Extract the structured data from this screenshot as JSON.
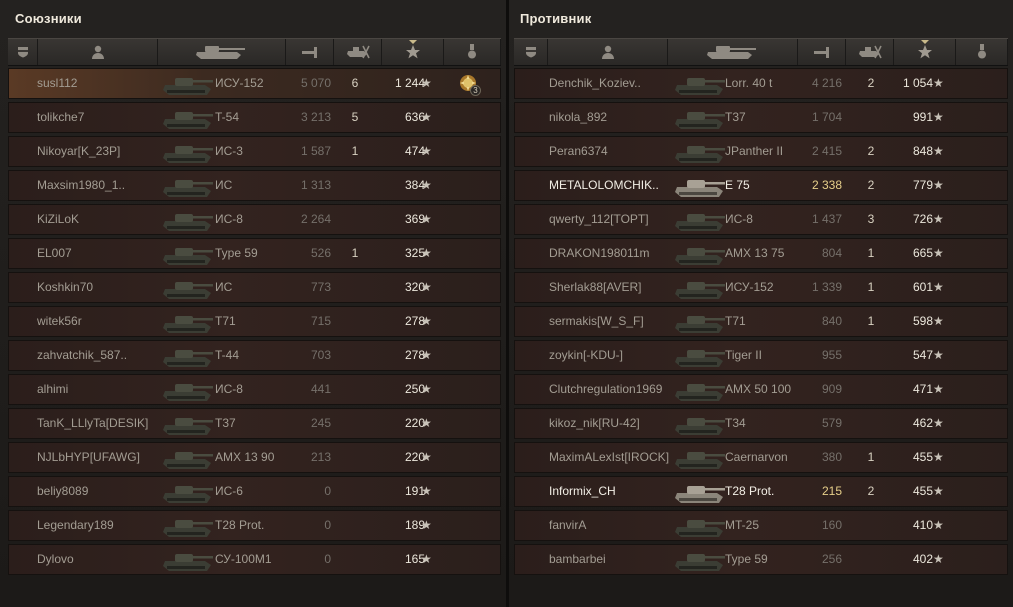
{
  "allies": {
    "title": "Союзники",
    "rows": [
      {
        "name": "susl112",
        "vehicle": "ИСУ-152",
        "damage": "5 070",
        "kills": "6",
        "xp": "1 244",
        "highlight": true,
        "alive": false,
        "medal_count": "3"
      },
      {
        "name": "tolikche7",
        "vehicle": "T-54",
        "damage": "3 213",
        "kills": "5",
        "xp": "636"
      },
      {
        "name": "Nikoyar[K_23P]",
        "vehicle": "ИС-3",
        "damage": "1 587",
        "kills": "1",
        "xp": "474"
      },
      {
        "name": "Maxsim1980_1..",
        "vehicle": "ИС",
        "damage": "1 313",
        "kills": "",
        "xp": "384"
      },
      {
        "name": "KiZiLoK",
        "vehicle": "ИС-8",
        "damage": "2 264",
        "kills": "",
        "xp": "369"
      },
      {
        "name": "EL007",
        "vehicle": "Type 59",
        "damage": "526",
        "kills": "1",
        "xp": "325"
      },
      {
        "name": "Koshkin70",
        "vehicle": "ИС",
        "damage": "773",
        "kills": "",
        "xp": "320"
      },
      {
        "name": "witek56r",
        "vehicle": "T71",
        "damage": "715",
        "kills": "",
        "xp": "278"
      },
      {
        "name": "zahvatchik_587..",
        "vehicle": "T-44",
        "damage": "703",
        "kills": "",
        "xp": "278"
      },
      {
        "name": "alhimi",
        "vehicle": "ИС-8",
        "damage": "441",
        "kills": "",
        "xp": "250"
      },
      {
        "name": "TanK_LLlyTa[DESIK]",
        "vehicle": "T37",
        "damage": "245",
        "kills": "",
        "xp": "220"
      },
      {
        "name": "NJLbHYP[UFAWG]",
        "vehicle": "AMX 13 90",
        "damage": "213",
        "kills": "",
        "xp": "220"
      },
      {
        "name": "beliy8089",
        "vehicle": "ИС-6",
        "damage": "0",
        "kills": "",
        "xp": "191"
      },
      {
        "name": "Legendary189",
        "vehicle": "T28 Prot.",
        "damage": "0",
        "kills": "",
        "xp": "189"
      },
      {
        "name": "Dylovo",
        "vehicle": "СУ-100М1",
        "damage": "0",
        "kills": "",
        "xp": "165"
      }
    ]
  },
  "enemies": {
    "title": "Противник",
    "rows": [
      {
        "name": "Denchik_Koziev..",
        "vehicle": "Lorr. 40 t",
        "damage": "4 216",
        "kills": "2",
        "xp": "1 054"
      },
      {
        "name": "nikola_892",
        "vehicle": "T37",
        "damage": "1 704",
        "kills": "",
        "xp": "991"
      },
      {
        "name": "Peran6374",
        "vehicle": "JPanther II",
        "damage": "2 415",
        "kills": "2",
        "xp": "848"
      },
      {
        "name": "METALOLOMCHIK..",
        "vehicle": "E 75",
        "damage": "2 338",
        "kills": "2",
        "xp": "779",
        "alive": true
      },
      {
        "name": "qwerty_112[TOPT]",
        "vehicle": "ИС-8",
        "damage": "1 437",
        "kills": "3",
        "xp": "726"
      },
      {
        "name": "DRAKON198011m",
        "vehicle": "AMX 13 75",
        "damage": "804",
        "kills": "1",
        "xp": "665"
      },
      {
        "name": "Sherlak88[AVER]",
        "vehicle": "ИСУ-152",
        "damage": "1 339",
        "kills": "1",
        "xp": "601"
      },
      {
        "name": "sermakis[W_S_F]",
        "vehicle": "T71",
        "damage": "840",
        "kills": "1",
        "xp": "598"
      },
      {
        "name": "zoykin[-KDU-]",
        "vehicle": "Tiger II",
        "damage": "955",
        "kills": "",
        "xp": "547"
      },
      {
        "name": "Clutchregulation1969",
        "vehicle": "AMX 50 100",
        "damage": "909",
        "kills": "",
        "xp": "471"
      },
      {
        "name": "kikoz_nik[RU-42]",
        "vehicle": "T34",
        "damage": "579",
        "kills": "",
        "xp": "462"
      },
      {
        "name": "MaximALexIst[IROCK]",
        "vehicle": "Caernarvon",
        "damage": "380",
        "kills": "1",
        "xp": "455"
      },
      {
        "name": "Informix_CH",
        "vehicle": "T28 Prot.",
        "damage": "215",
        "kills": "2",
        "xp": "455",
        "alive": true
      },
      {
        "name": "fanvirA",
        "vehicle": "MT-25",
        "damage": "160",
        "kills": "",
        "xp": "410"
      },
      {
        "name": "bambarbei",
        "vehicle": "Type 59",
        "damage": "256",
        "kills": "",
        "xp": "402"
      }
    ]
  },
  "star_glyph": "★",
  "icons": [
    "squad-icon",
    "player-icon",
    "vehicle-icon",
    "damage-icon",
    "frags-icon",
    "xp-star-icon",
    "medal-icon"
  ]
}
